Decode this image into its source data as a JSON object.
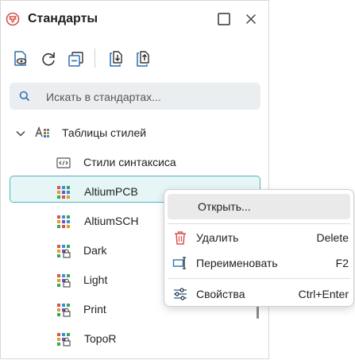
{
  "header": {
    "title": "Стандарты"
  },
  "search": {
    "placeholder": "Искать в стандартах..."
  },
  "tree": {
    "group": {
      "label": "Таблицы стилей"
    },
    "items": [
      {
        "label": "Стили синтаксиса",
        "icon": "code-icon"
      },
      {
        "label": "AltiumPCB",
        "icon": "style-grid-icon"
      },
      {
        "label": "AltiumSCH",
        "icon": "style-grid-icon"
      },
      {
        "label": "Dark",
        "icon": "style-grid-lock-icon"
      },
      {
        "label": "Light",
        "icon": "style-grid-lock-icon"
      },
      {
        "label": "Print",
        "icon": "style-grid-lock-icon"
      },
      {
        "label": "TopoR",
        "icon": "style-grid-lock-icon"
      }
    ],
    "selected_index": 1
  },
  "context_menu": {
    "open": {
      "label": "Открыть..."
    },
    "delete": {
      "label": "Удалить",
      "shortcut": "Delete"
    },
    "rename": {
      "label": "Переименовать",
      "shortcut": "F2"
    },
    "properties": {
      "label": "Свойства",
      "shortcut": "Ctrl+Enter"
    }
  },
  "colors": {
    "accent": "#4cb6bf",
    "selection_bg": "#e6f5f6",
    "delete_red": "#d9534f",
    "icon_blue": "#2f6fb0"
  }
}
